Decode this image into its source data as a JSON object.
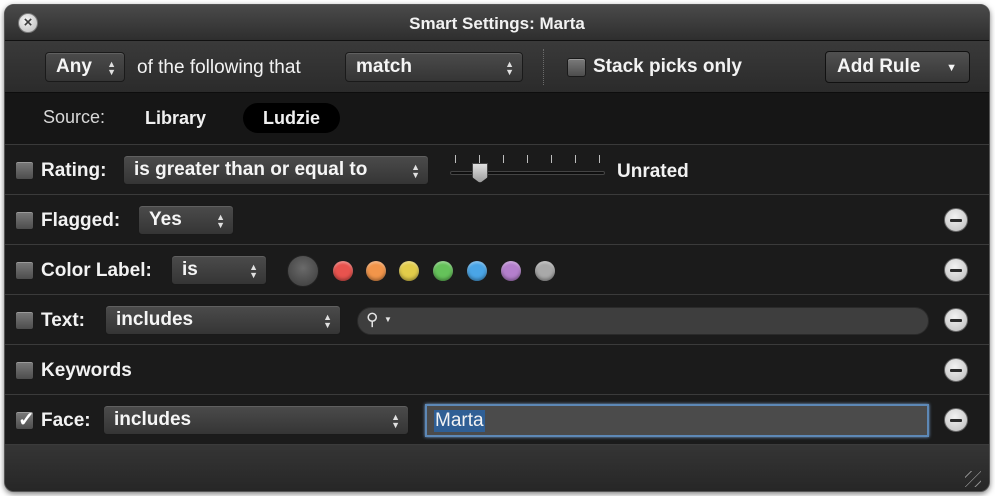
{
  "window": {
    "title": "Smart Settings: Marta"
  },
  "toolbar": {
    "quantifier": "Any",
    "connector_text": "of the following that",
    "match_mode": "match",
    "stack_picks_label": "Stack picks only",
    "add_rule_label": "Add Rule"
  },
  "source": {
    "label": "Source:",
    "options": [
      "Library",
      "Ludzie"
    ],
    "selected": "Ludzie"
  },
  "rules": {
    "rating": {
      "label": "Rating:",
      "operator": "is greater than or equal to",
      "value": "Unrated",
      "checked": false
    },
    "flagged": {
      "label": "Flagged:",
      "value": "Yes",
      "checked": false
    },
    "color_label": {
      "label": "Color Label:",
      "operator": "is",
      "colors": [
        "#e8534e",
        "#f2954a",
        "#e2cc4a",
        "#65c25a",
        "#4aa5e6",
        "#b47fcc",
        "#a9a9a9"
      ],
      "checked": false
    },
    "text": {
      "label": "Text:",
      "operator": "includes",
      "search_value": "",
      "checked": false
    },
    "keywords": {
      "label": "Keywords",
      "checked": false
    },
    "face": {
      "label": "Face:",
      "operator": "includes",
      "value": "Marta",
      "checked": true
    }
  },
  "icons": {
    "close": "close-icon",
    "remove": "minus-circle-icon",
    "search": "magnifier-icon",
    "resize": "resize-grip-icon"
  }
}
